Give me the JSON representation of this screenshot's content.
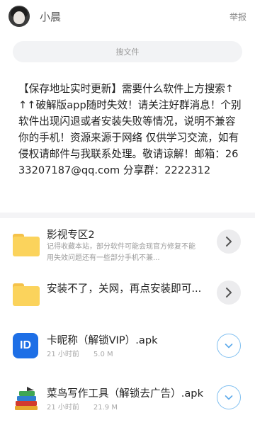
{
  "header": {
    "username": "小晨",
    "report_label": "举报"
  },
  "search": {
    "label": "搜文件"
  },
  "notice": {
    "text": "【保存地址实时更新】需要什么软件上方搜索↑↑↑破解版app随时失效！请关注好群消息！个别软件出现闪退或者安装失败等情况，说明不兼容你的手机！资源来源于网络 仅供学习交流，如有侵权请邮件与我联系处理。敬请谅解！邮箱：2633207187@qq.com 分享群：2222312"
  },
  "items": [
    {
      "type": "folder",
      "title": "影视专区2",
      "desc": "记得收藏本站，部分软件可能会现官方修复不能用失效问题还有一些部分手机不兼...",
      "icon": "folder-icon"
    },
    {
      "type": "folder",
      "title": "安装不了，关网，再点安装即可...",
      "icon": "folder-icon"
    },
    {
      "type": "file",
      "title": "卡昵称（解锁VIP）.apk",
      "time": "21 小时前",
      "size": "5.0 M",
      "icon": "app-icon",
      "icon_text": "ID"
    },
    {
      "type": "file",
      "title": "菜鸟写作工具（解锁去广告）.apk",
      "time": "21 小时前",
      "size": "21.9 M",
      "icon": "books-icon"
    }
  ],
  "colors": {
    "folder": "#fbd35c",
    "accent_blue": "#1e6fe6",
    "download_ring": "#7fbff0"
  }
}
